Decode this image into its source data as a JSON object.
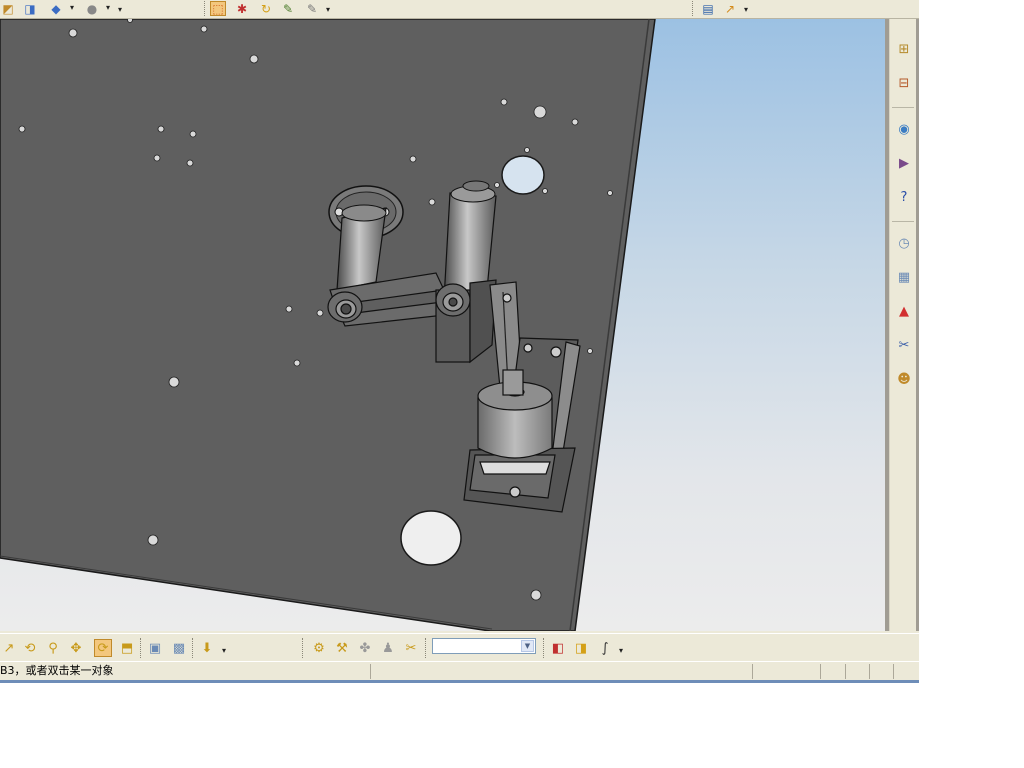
{
  "app": {
    "accent": "#316ac5",
    "status_line_color": "#6e8db8"
  },
  "top_toolbar": {
    "items": [
      {
        "name": "save-icon",
        "glyph": "◩",
        "color": "#c08a2a"
      },
      {
        "name": "save-dropdown-icon",
        "glyph": "◨",
        "color": "#3b6cc3"
      },
      {
        "name": "view-cube-icon",
        "glyph": "◆",
        "color": "#3b6cc3"
      },
      {
        "name": "render-icon",
        "glyph": "●",
        "color": "#888"
      },
      {
        "name": "select-icon",
        "glyph": "⬚",
        "color": "#d0601a"
      },
      {
        "name": "select-other-icon",
        "glyph": "✱",
        "color": "#c03030"
      },
      {
        "name": "rebuild-icon",
        "glyph": "↻",
        "color": "#d4a017"
      },
      {
        "name": "options-icon",
        "glyph": "✎",
        "color": "#4a7b2a"
      },
      {
        "name": "measure-icon",
        "glyph": "✎",
        "color": "#777"
      },
      {
        "name": "layout-icon",
        "glyph": "▤",
        "color": "#2a5ea8"
      },
      {
        "name": "sketch-icon",
        "glyph": "↗",
        "color": "#d48a1a"
      }
    ]
  },
  "task_pane": {
    "items": [
      {
        "name": "feature-tree-icon",
        "glyph": "⊞",
        "color": "#b58a2a"
      },
      {
        "name": "property-tree-icon",
        "glyph": "⊟",
        "color": "#b55a2a"
      },
      {
        "name": "resources-icon",
        "glyph": "◉",
        "color": "#3b7dc3"
      },
      {
        "name": "design-library-icon",
        "glyph": "▶",
        "color": "#7a4a8a"
      },
      {
        "name": "help-icon",
        "glyph": "?",
        "color": "#2a4ea8"
      },
      {
        "name": "history-icon",
        "glyph": "◷",
        "color": "#6b8bb5"
      },
      {
        "name": "file-explorer-icon",
        "glyph": "▦",
        "color": "#6a8ab5"
      },
      {
        "name": "appearance-icon",
        "glyph": "▲",
        "color": "#d23030"
      },
      {
        "name": "custom-properties-icon",
        "glyph": "✂",
        "color": "#3a5ea8"
      },
      {
        "name": "community-icon",
        "glyph": "☻",
        "color": "#c08a2a"
      }
    ]
  },
  "bottom_toolbar": {
    "items": [
      {
        "name": "view-orient-icon",
        "glyph": "↗",
        "color": "#c89a1a"
      },
      {
        "name": "zoom-fit-icon",
        "glyph": "⟲",
        "color": "#c89a1a"
      },
      {
        "name": "zoom-area-icon",
        "glyph": "⚲",
        "color": "#c89a1a"
      },
      {
        "name": "pan-icon",
        "glyph": "✥",
        "color": "#c89a1a"
      },
      {
        "name": "rotate-view-icon",
        "glyph": "⟳",
        "color": "#c89a1a"
      },
      {
        "name": "section-view-icon",
        "glyph": "⬒",
        "color": "#c89a1a"
      },
      {
        "name": "display-style-icon",
        "glyph": "▣",
        "color": "#6a8ab5"
      },
      {
        "name": "hide-show-icon",
        "glyph": "▩",
        "color": "#6a8ab5"
      },
      {
        "name": "apply-scene-icon",
        "glyph": "⬇",
        "color": "#c89a1a"
      },
      {
        "name": "mate-icon",
        "glyph": "⚙",
        "color": "#c89a1a"
      },
      {
        "name": "insert-component-icon",
        "glyph": "⚒",
        "color": "#c89a1a"
      },
      {
        "name": "move-component-icon",
        "glyph": "✤",
        "color": "#999"
      },
      {
        "name": "smart-fastener-icon",
        "glyph": "♟",
        "color": "#999"
      },
      {
        "name": "explode-icon",
        "glyph": "✂",
        "color": "#c89a1a"
      },
      {
        "name": "view-prev-icon",
        "glyph": "◧",
        "color": "#c03030"
      },
      {
        "name": "view-next-icon",
        "glyph": "◨",
        "color": "#d4a017"
      },
      {
        "name": "line-icon",
        "glyph": "∫",
        "color": "#333"
      }
    ],
    "filter_select_value": ""
  },
  "status": {
    "text": "B3，或者双击某一对象"
  }
}
